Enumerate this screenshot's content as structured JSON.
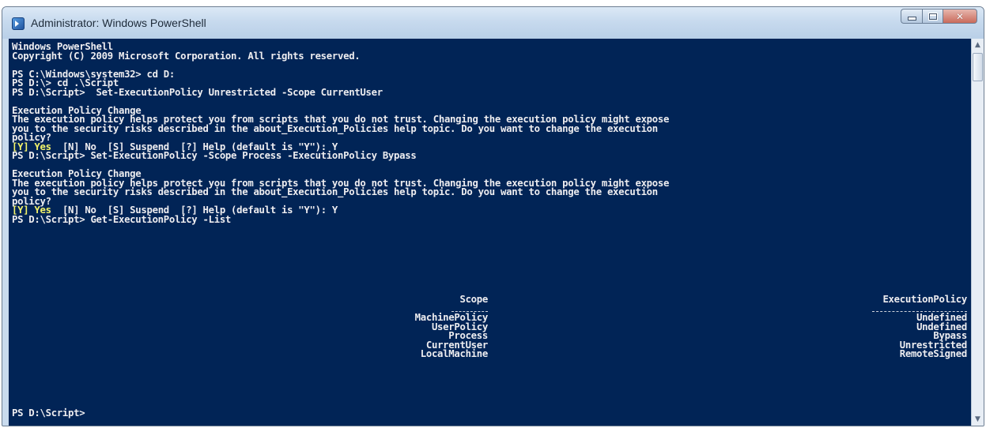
{
  "window": {
    "title": "Administrator: Windows PowerShell",
    "icon": "powershell-icon",
    "controls": {
      "minimize": "minimize-icon",
      "maximize": "maximize-icon",
      "close": "close-icon"
    }
  },
  "console": {
    "colors": {
      "background": "#012456",
      "foreground": "#eeedf0",
      "highlight": "#f3f36a"
    },
    "lines": [
      "Windows PowerShell",
      "Copyright (C) 2009 Microsoft Corporation. All rights reserved.",
      "",
      "PS C:\\Windows\\system32> cd D:",
      "PS D:\\> cd .\\Script",
      "PS D:\\Script>  Set-ExecutionPolicy Unrestricted -Scope CurrentUser",
      "",
      "Execution Policy Change",
      "The execution policy helps protect you from scripts that you do not trust. Changing the execution policy might expose",
      "you to the security risks described in the about_Execution_Policies help topic. Do you want to change the execution",
      "policy?"
    ],
    "choice1_highlight": "[Y] Yes",
    "choice1_rest": "  [N] No  [S] Suspend  [?] Help (default is \"Y\"): Y",
    "lines2": [
      "PS D:\\Script> Set-ExecutionPolicy -Scope Process -ExecutionPolicy Bypass",
      "",
      "Execution Policy Change",
      "The execution policy helps protect you from scripts that you do not trust. Changing the execution policy might expose",
      "you to the security risks described in the about_Execution_Policies help topic. Do you want to change the execution",
      "policy?"
    ],
    "choice2_highlight": "[Y] Yes",
    "choice2_rest": "  [N] No  [S] Suspend  [?] Help (default is \"Y\"): Y",
    "lines3": [
      "PS D:\\Script> Get-ExecutionPolicy -List"
    ],
    "table": {
      "headers": {
        "scope": "Scope",
        "policy": "ExecutionPolicy"
      },
      "rows": [
        {
          "scope": "MachinePolicy",
          "policy": "Undefined"
        },
        {
          "scope": "UserPolicy",
          "policy": "Undefined"
        },
        {
          "scope": "Process",
          "policy": "Bypass"
        },
        {
          "scope": "CurrentUser",
          "policy": "Unrestricted"
        },
        {
          "scope": "LocalMachine",
          "policy": "RemoteSigned"
        }
      ]
    },
    "prompt": "PS D:\\Script>"
  }
}
